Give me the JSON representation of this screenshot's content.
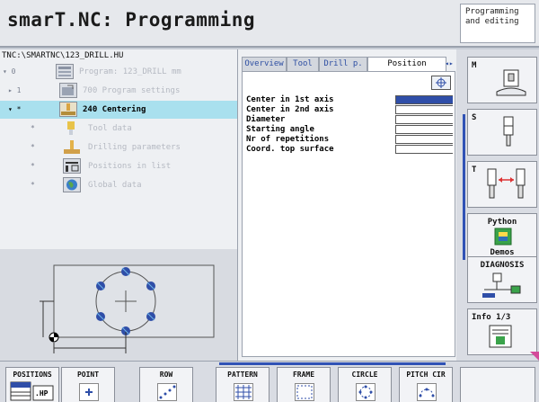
{
  "header": {
    "title": "smarT.NC: Programming",
    "mode_line1": "Programming",
    "mode_line2": "and editing"
  },
  "left": {
    "path": "TNC:\\SMARTNC\\123_DRILL.HU",
    "tree": [
      {
        "marker": "▾ 0",
        "label": "Program: 123_DRILL mm"
      },
      {
        "marker": "▸ 1",
        "label": "700 Program settings"
      },
      {
        "marker": "▾ *",
        "label": "240 Centering"
      },
      {
        "marker": "*",
        "label": "Tool data"
      },
      {
        "marker": "*",
        "label": "Drilling parameters"
      },
      {
        "marker": "*",
        "label": "Positions in list"
      },
      {
        "marker": "*",
        "label": "Global data"
      }
    ]
  },
  "form": {
    "tabs": [
      "Overview",
      "Tool",
      "Drill p.",
      "Position"
    ],
    "active_tab": "Position",
    "tab_scroll": "◂▸",
    "fields": [
      {
        "label": "Center in 1st axis",
        "value": ""
      },
      {
        "label": "Center in 2nd axis",
        "value": ""
      },
      {
        "label": "Diameter",
        "value": ""
      },
      {
        "label": "Starting angle",
        "value": ""
      },
      {
        "label": "Nr of repetitions",
        "value": ""
      },
      {
        "label": "Coord. top surface",
        "value": ""
      }
    ]
  },
  "right_softkeys": {
    "m": "M",
    "s": "S",
    "t": "T",
    "python_line1": "Python",
    "python_line2": "Demos",
    "diagnosis": "DIAGNOSIS",
    "info": "Info 1/3"
  },
  "bottom_softkeys": [
    "POSITIONS",
    "POINT",
    "ROW",
    "PATTERN",
    "FRAME",
    "CIRCLE",
    "PITCH CIR",
    ""
  ],
  "positions_icon_text": ".HP",
  "colors": {
    "accent": "#3052b5",
    "selection": "#a9e0ee",
    "active_field": "#2f4ea8"
  }
}
